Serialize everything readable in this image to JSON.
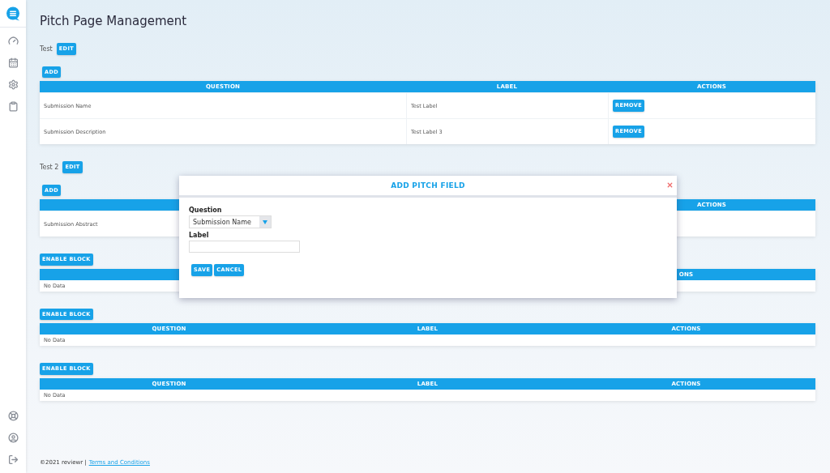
{
  "page": {
    "title": "Pitch Page Management"
  },
  "blocks": [
    {
      "kind": "named",
      "name": "Test",
      "edit": "EDIT",
      "add": "ADD",
      "table": {
        "columns": [
          "QUESTION",
          "LABEL",
          "ACTIONS"
        ],
        "rows": [
          {
            "question": "Submission Name",
            "label": "Test Label",
            "action": "REMOVE"
          },
          {
            "question": "Submission Description",
            "label": "Test Label 3",
            "action": "REMOVE"
          }
        ]
      }
    },
    {
      "kind": "named",
      "name": "Test 2",
      "edit": "EDIT",
      "add": "ADD",
      "table": {
        "columns": [
          "ACTIONS"
        ],
        "rows": [
          {
            "question": "Submission Abstract"
          }
        ]
      }
    },
    {
      "kind": "disabled",
      "enable": "ENABLE BLOCK",
      "table": {
        "columns": [
          "ONS"
        ],
        "empty_text": "No Data"
      }
    },
    {
      "kind": "disabled",
      "enable": "ENABLE BLOCK",
      "table": {
        "columns": [
          "QUESTION",
          "LABEL",
          "ACTIONS"
        ],
        "empty_text": "No Data"
      }
    },
    {
      "kind": "disabled",
      "enable": "ENABLE BLOCK",
      "table": {
        "columns": [
          "QUESTION",
          "LABEL",
          "ACTIONS"
        ],
        "empty_text": "No Data"
      }
    }
  ],
  "footer": {
    "copyright": "©2021 reviewr |",
    "link": "Terms and Conditions"
  },
  "modal": {
    "title": "ADD PITCH FIELD",
    "fields": [
      {
        "kind": "select",
        "label": "Question",
        "value": "Submission Name"
      },
      {
        "kind": "text",
        "label": "Label"
      }
    ],
    "buttons": [
      "SAVE",
      "CANCEL"
    ]
  }
}
